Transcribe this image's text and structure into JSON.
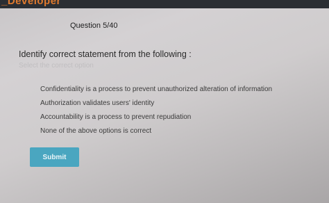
{
  "header": {
    "title": "_Developer"
  },
  "quiz": {
    "counter": "Question 5/40",
    "question": "Identify correct statement from the following :",
    "instruction": "Select the correct option",
    "options": [
      "Confidentiality is a process to prevent unauthorized alteration of information",
      "Authorization validates users' identity",
      "Accountability is a process to prevent repudiation",
      "None of the above options is correct"
    ],
    "submit_label": "Submit"
  },
  "colors": {
    "top_bar": "#2b2e33",
    "brand_accent": "#e07a2e",
    "submit_button": "#4aa6c0"
  }
}
